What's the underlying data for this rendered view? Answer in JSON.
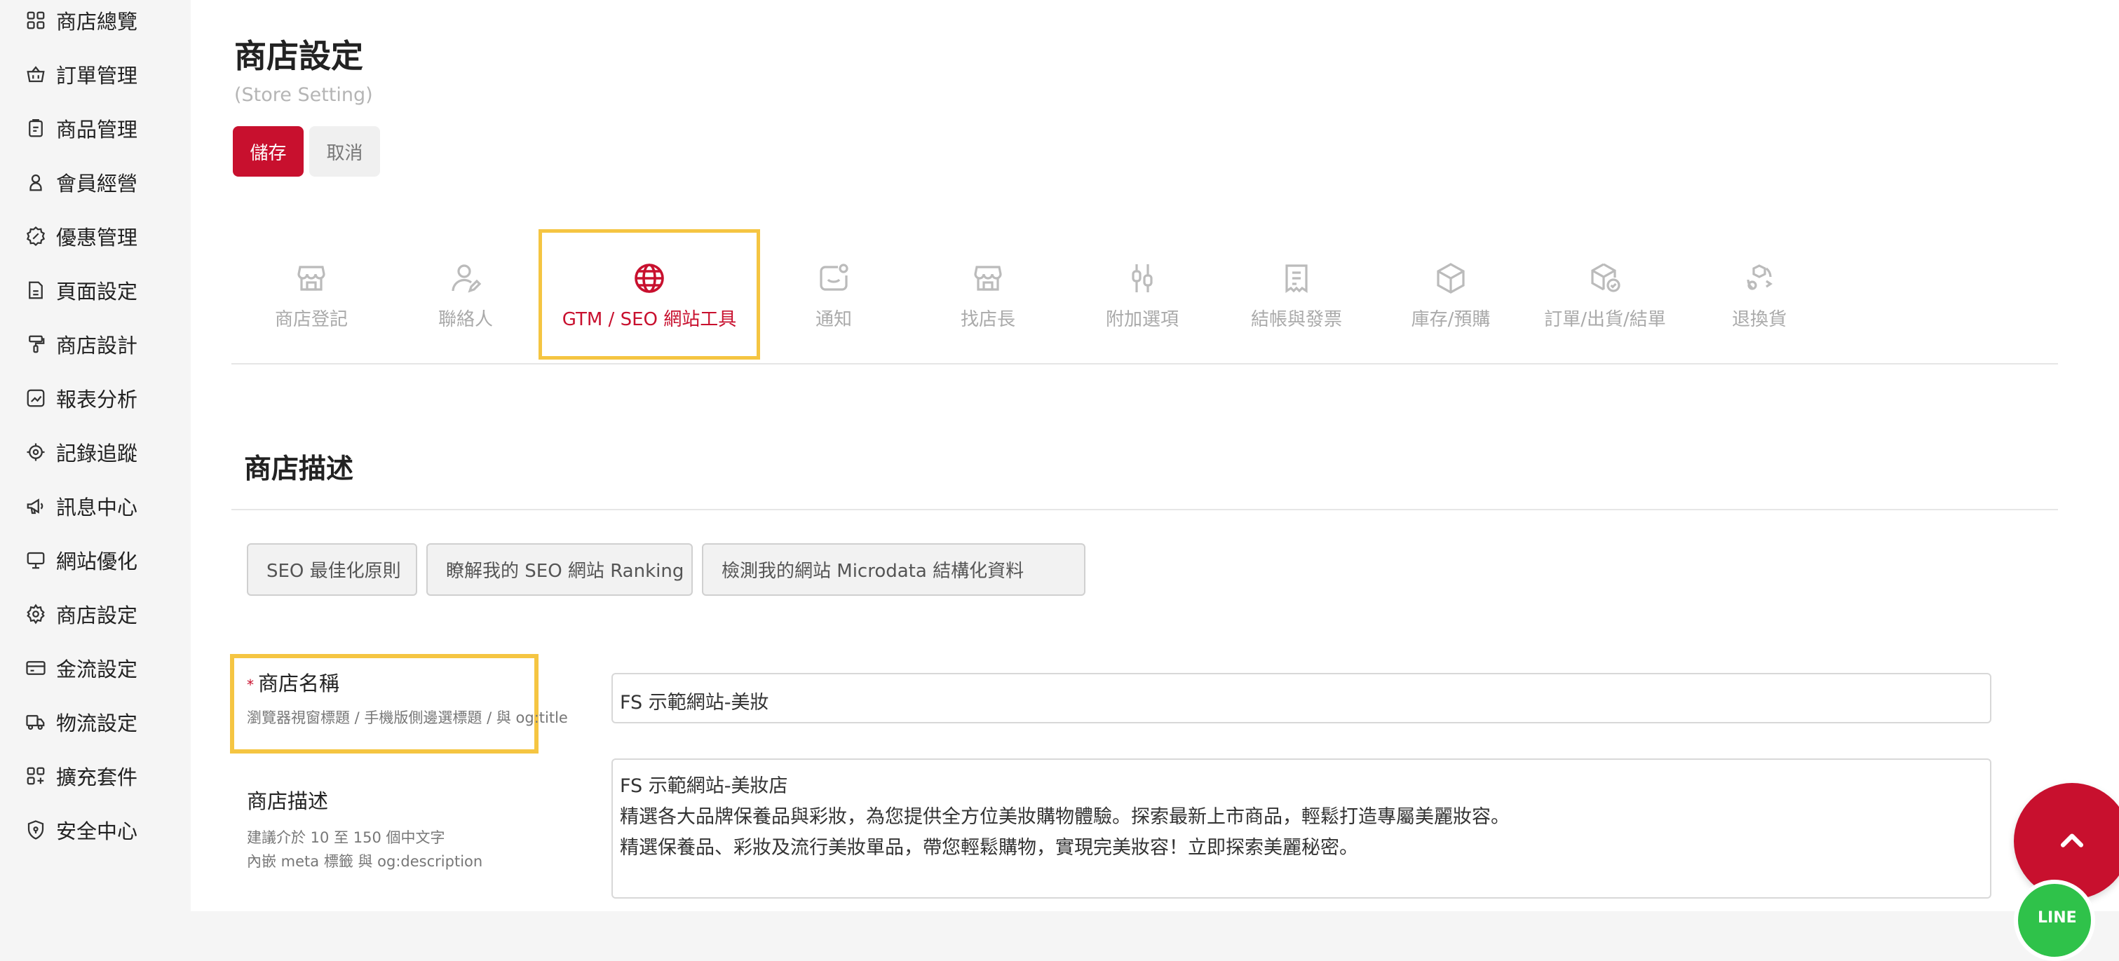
{
  "sidebar": {
    "items": [
      {
        "label": "商店總覽",
        "icon": "grid-icon"
      },
      {
        "label": "訂單管理",
        "icon": "basket-icon"
      },
      {
        "label": "商品管理",
        "icon": "clipboard-icon"
      },
      {
        "label": "會員經營",
        "icon": "user-icon"
      },
      {
        "label": "優惠管理",
        "icon": "badge-percent-icon"
      },
      {
        "label": "頁面設定",
        "icon": "page-icon"
      },
      {
        "label": "商店設計",
        "icon": "brush-icon"
      },
      {
        "label": "報表分析",
        "icon": "chart-icon"
      },
      {
        "label": "記錄追蹤",
        "icon": "target-icon"
      },
      {
        "label": "訊息中心",
        "icon": "megaphone-icon"
      },
      {
        "label": "網站優化",
        "icon": "monitor-icon"
      },
      {
        "label": "商店設定",
        "icon": "gear-icon"
      },
      {
        "label": "金流設定",
        "icon": "credit-card-icon"
      },
      {
        "label": "物流設定",
        "icon": "truck-icon"
      },
      {
        "label": "擴充套件",
        "icon": "plus-grid-icon"
      },
      {
        "label": "安全中心",
        "icon": "shield-icon"
      }
    ]
  },
  "header": {
    "title": "商店設定",
    "subtitle": "(Store Setting)",
    "save_label": "儲存",
    "cancel_label": "取消"
  },
  "tabs": [
    {
      "label": "商店登記",
      "icon": "store-icon",
      "active": false
    },
    {
      "label": "聯絡人",
      "icon": "contact-person-icon",
      "active": false
    },
    {
      "label": "GTM / SEO 網站工具",
      "icon": "globe-icon",
      "active": true
    },
    {
      "label": "通知",
      "icon": "notification-icon",
      "active": false
    },
    {
      "label": "找店長",
      "icon": "store-icon",
      "active": false
    },
    {
      "label": "附加選項",
      "icon": "sliders-icon",
      "active": false
    },
    {
      "label": "結帳與發票",
      "icon": "receipt-icon",
      "active": false
    },
    {
      "label": "庫存/預購",
      "icon": "box-icon",
      "active": false
    },
    {
      "label": "訂單/出貨/結單",
      "icon": "box-check-icon",
      "active": false
    },
    {
      "label": "退換貨",
      "icon": "exchange-icon",
      "active": false
    }
  ],
  "section": {
    "title": "商店描述",
    "buttons": [
      "SEO 最佳化原則",
      "瞭解我的 SEO 網站 Ranking",
      "檢測我的網站 Microdata 結構化資料"
    ]
  },
  "store_name": {
    "required_mark": "*",
    "label": "商店名稱",
    "hint": "瀏覽器視窗標題 / 手機版側邊選標題 / 與 og:title",
    "value": "FS 示範網站-美妝"
  },
  "store_desc": {
    "label": "商店描述",
    "hint1": "建議介於 10 至 150 個中文字",
    "hint2": "內嵌 meta 標籤 與 og:description",
    "lines": [
      "FS 示範網站-美妝店",
      "精選各大品牌保養品與彩妝，為您提供全方位美妝購物體驗。探索最新上市商品，輕鬆打造專屬美麗妝容。",
      "精選保養品、彩妝及流行美妝單品，帶您輕鬆購物，實現完美妝容！立即探索美麗秘密。"
    ]
  },
  "floating": {
    "line_label": "LINE"
  },
  "colors": {
    "accent": "#c8102e",
    "highlight": "#f5c542",
    "line_green": "#2fc24a"
  }
}
